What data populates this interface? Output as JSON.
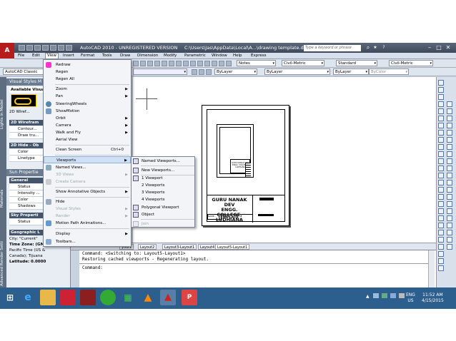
{
  "window": {
    "title": "AutoCAD 2010 - UNREGISTERED VERSION",
    "path": "C:\\Users\\Jas\\AppData\\Local\\A...\\drawing template.dw",
    "search_placeholder": "Type a keyword or phrase"
  },
  "menubar": [
    "File",
    "Edit",
    "View",
    "Insert",
    "Format",
    "Tools",
    "Draw",
    "Dimension",
    "Modify",
    "Parametric",
    "Window",
    "Help",
    "Express"
  ],
  "toolbar": {
    "workspace": "AutoCAD Classic",
    "text_style": "Notes",
    "dim_style": "Civil-Metric",
    "table_style": "Standard",
    "multileader_style": "Civil-Metric",
    "layer_color": "ByLayer",
    "linetype": "ByLayer",
    "lineweight": "ByLayer",
    "plot_style": "ByColor"
  },
  "side_tabs": [
    "Lights in Model",
    "Materials",
    "Advanced Render Setti"
  ],
  "palette": {
    "visual_styles_header": "Visual Styles M",
    "available_label": "Available Visual",
    "thumb_label": "2D Wiref...",
    "section1": "2D Wirefram",
    "rows1": [
      "Contour...",
      "Draw tru..."
    ],
    "section2": "2D Hide - Ob",
    "rows2": [
      "Color",
      "Linetype"
    ],
    "sun_header": "Sun Propertie",
    "general": "General",
    "rows3": [
      "Status",
      "Intensity ...",
      "Color",
      "Shadows"
    ],
    "sky": "Sky Properti",
    "rows4": [
      "Status"
    ],
    "geo": "Geographic L",
    "geo_lines": [
      "City: \"Current\"",
      "Time Zone: (GMT-08:00)",
      "Pacific Time (US &",
      "Canada); Tijuana",
      "Latitude: 0.0000"
    ]
  },
  "view_menu": {
    "items": [
      {
        "label": "Redraw"
      },
      {
        "label": "Regen"
      },
      {
        "label": "Regen All"
      },
      {
        "label": "Zoom",
        "arrow": true
      },
      {
        "label": "Pan",
        "arrow": true
      },
      {
        "label": "SteeringWheels"
      },
      {
        "label": "ShowMotion"
      },
      {
        "label": "Orbit",
        "arrow": true
      },
      {
        "label": "Camera",
        "arrow": true
      },
      {
        "label": "Walk and Fly",
        "arrow": true
      },
      {
        "label": "Aerial View"
      },
      {
        "label": "Clean Screen",
        "shortcut": "Ctrl+0"
      },
      {
        "label": "Viewports",
        "arrow": true
      },
      {
        "label": "Named Views..."
      },
      {
        "label": "3D Views",
        "arrow": true
      },
      {
        "label": "Create Camera"
      },
      {
        "label": "Show Annotative Objects",
        "arrow": true
      },
      {
        "label": "Hide"
      },
      {
        "label": "Visual Styles",
        "arrow": true
      },
      {
        "label": "Render",
        "arrow": true
      },
      {
        "label": "Motion Path Animations..."
      },
      {
        "label": "Display",
        "arrow": true
      },
      {
        "label": "Toolbars..."
      }
    ]
  },
  "viewports_submenu": [
    "Named Viewports...",
    "New Viewports...",
    "1 Viewport",
    "2 Viewports",
    "3 Viewports",
    "4 Viewports",
    "Polygonal Viewport",
    "Object",
    "Join"
  ],
  "drawing": {
    "college_line1": "GURU NANAK DEV",
    "college_line2": "ENGG. COLLEGE,",
    "college_line3": "LUDHIANA",
    "template_label": "TEMPLATE",
    "small_line1": "GURU NANAK DEV",
    "small_line2": "ENGG. COLLEGE,",
    "small_line3": "LUDHIANA",
    "name_label": "NAME:-"
  },
  "layout_tabs": [
    "yout1",
    "Layout2",
    "Layout3-Layout1",
    "Layout4",
    "Layout5-Layout1"
  ],
  "command": {
    "line1": "Command:  <Switching to: Layout5-Layout1>",
    "line2": "Restoring cached viewports - Regenerating layout.",
    "line3": "Command:"
  },
  "taskbar": {
    "lang": "ENG",
    "region": "US",
    "time": "11:52 AM",
    "date": "4/15/2015"
  }
}
